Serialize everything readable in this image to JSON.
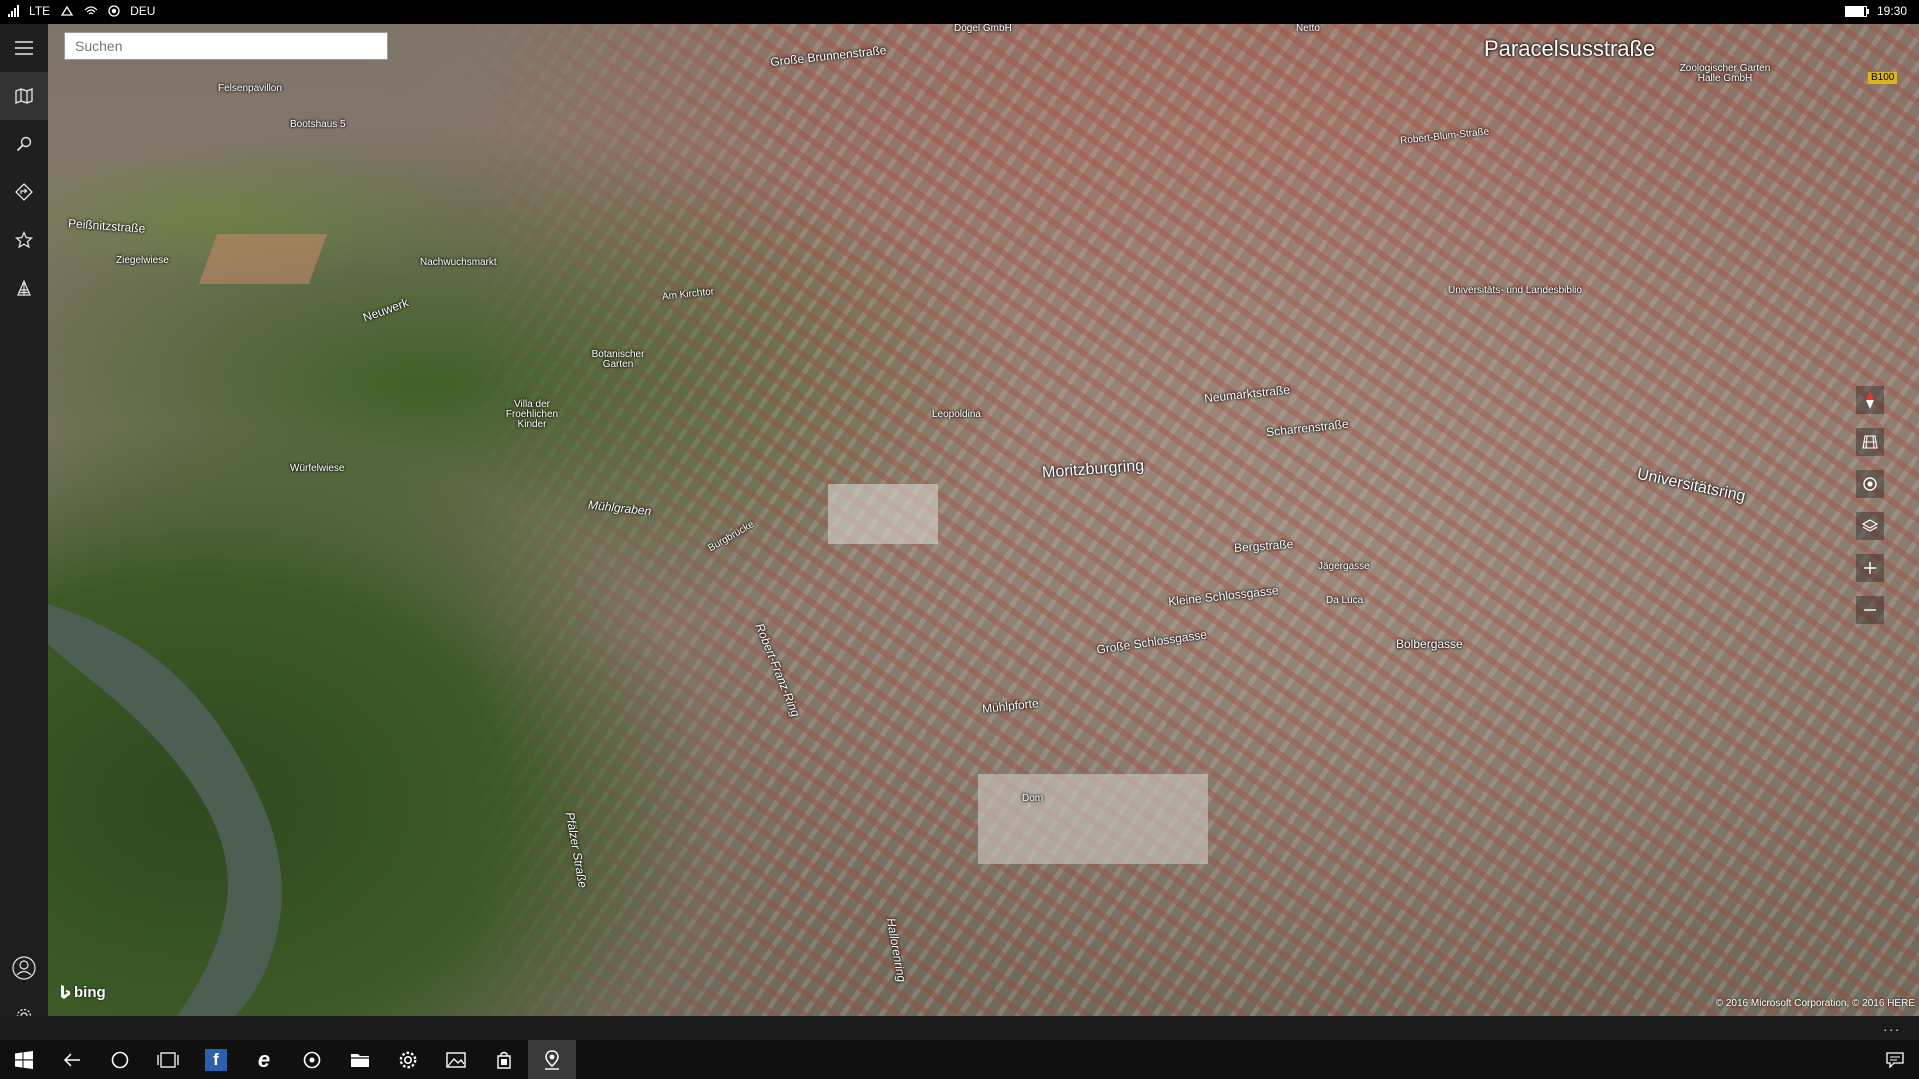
{
  "status_bar": {
    "network": "LTE",
    "language": "DEU",
    "time": "19:30",
    "battery_level": 0.9
  },
  "search": {
    "placeholder": "Suchen"
  },
  "rail": {
    "items": [
      {
        "icon": "hamburger-icon"
      },
      {
        "icon": "map-icon"
      },
      {
        "icon": "search-icon"
      },
      {
        "icon": "directions-icon"
      },
      {
        "icon": "star-icon"
      },
      {
        "icon": "3d-cities-icon"
      },
      {
        "icon": "user-icon"
      },
      {
        "icon": "gear-icon"
      }
    ]
  },
  "map": {
    "labels": {
      "paracelsusstrasse": "Paracelsusstraße",
      "universitatsring": "Universitätsring",
      "moritzburgring": "Moritzburgring",
      "neuwerk": "Neuwerk",
      "muhlgraben": "Mühlgraben",
      "robert_franz_ring": "Robert-Franz-Ring",
      "grosse_brunnenstrasse": "Große Brunnenstraße",
      "peissnitzstrasse": "Peißnitzstraße",
      "ziegelwiese": "Ziegelwiese",
      "wurfelwiese": "Würfelwiese",
      "dom": "Dom",
      "kleine_schlossgasse": "Kleine Schlossgasse",
      "grosse_schlossgasse": "Große Schlossgasse",
      "boelbergasse": "Bolbergasse",
      "muhlpforte": "Mühlpforte",
      "burgbrucke": "Burgbrücke",
      "neumarktstrasse": "Neumarktstraße",
      "scharrenstrasse": "Scharrenstraße",
      "robert_blum_strasse": "Robert-Blum-Straße",
      "bergstrasse": "Bergstraße",
      "jagergasse": "Jägergasse",
      "leopoldina": "Leopoldina",
      "botanischer_garten": "Botanischer Garten",
      "villa_der_froehlichen_kinder": "Villa der Froehlichen Kinder",
      "felsenpavillon": "Felsenpavillon",
      "bootshaus": "Bootshaus 5",
      "nachwuchsmarkt": "Nachwuchsmarkt",
      "am_kirchtor": "Am Kirchtor",
      "da_luca": "Da Luca",
      "pfalzer_strasse": "Pfälzer Straße",
      "hallorenring": "Hallorenring",
      "dogel_gmbh": "Dögel GmbH",
      "netto": "Netto",
      "zoologischer_garten": "Zoologischer Garten Halle GmbH",
      "universitats_bibliothek": "Universitäts- und Landesbiblio",
      "b100": "B100"
    }
  },
  "bing_label": "bing",
  "copyright": "© 2016 Microsoft Corporation, © 2016 HERE",
  "more_label": "...",
  "taskbar": {
    "items": [
      {
        "icon": "windows-start-icon"
      },
      {
        "icon": "back-arrow-icon"
      },
      {
        "icon": "cortana-icon"
      },
      {
        "icon": "task-view-icon"
      },
      {
        "icon": "facebook-icon"
      },
      {
        "icon": "edge-icon"
      },
      {
        "icon": "groove-icon"
      },
      {
        "icon": "file-explorer-icon"
      },
      {
        "icon": "settings-icon"
      },
      {
        "icon": "photos-icon"
      },
      {
        "icon": "store-icon"
      },
      {
        "icon": "maps-icon",
        "active": true
      },
      {
        "icon": "action-center-icon"
      }
    ],
    "facebook_glyph": "f",
    "edge_glyph": "e"
  }
}
